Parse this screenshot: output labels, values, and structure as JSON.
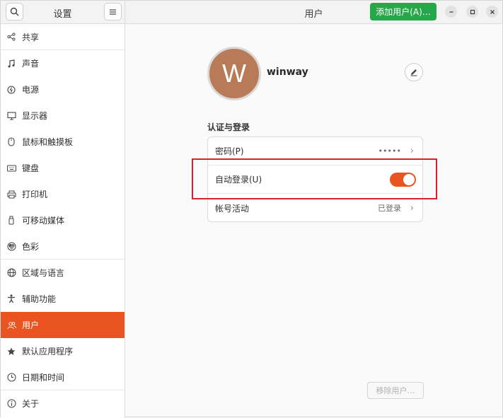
{
  "sidebar": {
    "title": "设置",
    "items": [
      {
        "label": "共享",
        "icon": "share-icon"
      },
      {
        "label": "声音",
        "icon": "music-note-icon"
      },
      {
        "label": "电源",
        "icon": "power-icon"
      },
      {
        "label": "显示器",
        "icon": "monitor-icon"
      },
      {
        "label": "鼠标和触摸板",
        "icon": "mouse-icon"
      },
      {
        "label": "键盘",
        "icon": "keyboard-icon"
      },
      {
        "label": "打印机",
        "icon": "printer-icon"
      },
      {
        "label": "可移动媒体",
        "icon": "usb-drive-icon"
      },
      {
        "label": "色彩",
        "icon": "color-icon"
      },
      {
        "label": "区域与语言",
        "icon": "globe-icon"
      },
      {
        "label": "辅助功能",
        "icon": "accessibility-icon"
      },
      {
        "label": "用户",
        "icon": "users-icon",
        "active": true
      },
      {
        "label": "默认应用程序",
        "icon": "star-icon"
      },
      {
        "label": "日期和时间",
        "icon": "clock-icon"
      },
      {
        "label": "关于",
        "icon": "info-icon"
      }
    ]
  },
  "header": {
    "title": "用户",
    "add_user_label": "添加用户(A)…"
  },
  "profile": {
    "avatar_letter": "W",
    "avatar_color": "#b97b57",
    "username": "winway"
  },
  "auth_section": {
    "title": "认证与登录",
    "password_label": "密码(P)",
    "password_value": "•••••",
    "autologin_label": "自动登录(U)",
    "autologin_enabled": true,
    "activity_label": "帐号活动",
    "activity_value": "已登录"
  },
  "remove_user_label": "移除用户…",
  "colors": {
    "accent": "#e95420",
    "add_button": "#26a84a",
    "highlight": "#d8212f"
  }
}
